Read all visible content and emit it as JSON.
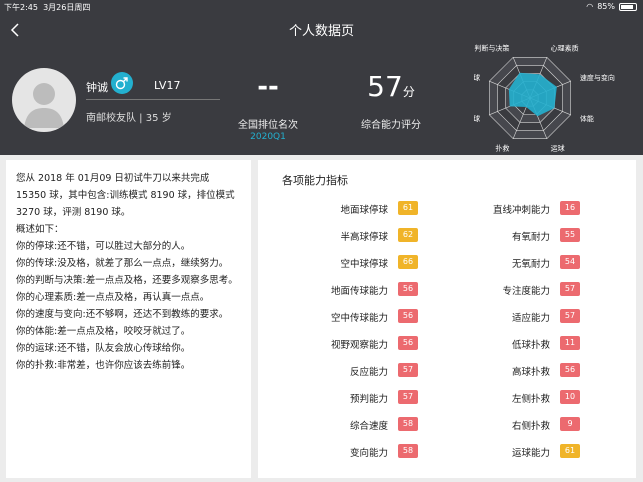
{
  "statusbar": {
    "time": "下午2:45",
    "date": "3月26日周四",
    "battery": "85%",
    "battery_level": 0.85
  },
  "header": {
    "title": "个人数据页"
  },
  "profile": {
    "name": "钟诚",
    "gender_icon": "male-icon",
    "level": "LV17",
    "team": "南邮校友队 | 35 岁"
  },
  "rank": {
    "value": "--",
    "label": "全国排位名次",
    "season": "2020Q1"
  },
  "score": {
    "value": "57",
    "unit": "分",
    "label": "综合能力评分"
  },
  "radar": {
    "labels": [
      "判断与决策",
      "心理素质",
      "速度与变向",
      "体能",
      "运球",
      "扑救",
      "停球",
      "传球"
    ],
    "values": [
      0.62,
      0.58,
      0.66,
      0.6,
      0.45,
      0.22,
      0.5,
      0.52
    ],
    "accent": "#23b0cf"
  },
  "summary": {
    "lines": [
      "您从 2018 年 01月09 日初试牛刀以来共完成 15350 球，其中包含:训练模式 8190 球，排位模式 3270 球，评测 8190 球。",
      "概述如下：",
      "你的停球:还不错，可以胜过大部分的人。",
      "你的传球:没及格，就差了那么一点点，继续努力。",
      "你的判断与决策:差一点点及格，还要多观察多思考。",
      "你的心理素质:差一点点及格，再认真一点点。",
      "你的速度与变向:还不够啊，还达不到教练的要求。",
      "你的体能:差一点点及格，咬咬牙就过了。",
      "你的运球:还不错，队友会放心传球给你。",
      "你的扑救:非常差，也许你应该去练前锋。"
    ]
  },
  "abilities": {
    "title": "各项能力指标",
    "colors": {
      "yellow": "#f0b429",
      "red": "#ec6a6f"
    },
    "left": [
      {
        "label": "地面球停球",
        "value": "61",
        "color": "yellow"
      },
      {
        "label": "半高球停球",
        "value": "62",
        "color": "yellow"
      },
      {
        "label": "空中球停球",
        "value": "66",
        "color": "yellow"
      },
      {
        "label": "地面传球能力",
        "value": "56",
        "color": "red"
      },
      {
        "label": "空中传球能力",
        "value": "56",
        "color": "red"
      },
      {
        "label": "视野观察能力",
        "value": "56",
        "color": "red"
      },
      {
        "label": "反应能力",
        "value": "57",
        "color": "red"
      },
      {
        "label": "预判能力",
        "value": "57",
        "color": "red"
      },
      {
        "label": "综合速度",
        "value": "58",
        "color": "red"
      },
      {
        "label": "变向能力",
        "value": "58",
        "color": "red"
      }
    ],
    "right": [
      {
        "label": "直线冲刺能力",
        "value": "16",
        "color": "red"
      },
      {
        "label": "有氧耐力",
        "value": "55",
        "color": "red"
      },
      {
        "label": "无氧耐力",
        "value": "54",
        "color": "red"
      },
      {
        "label": "专注度能力",
        "value": "57",
        "color": "red"
      },
      {
        "label": "适应能力",
        "value": "57",
        "color": "red"
      },
      {
        "label": "低球扑救",
        "value": "11",
        "color": "red"
      },
      {
        "label": "高球扑救",
        "value": "56",
        "color": "red"
      },
      {
        "label": "左侧扑救",
        "value": "10",
        "color": "red"
      },
      {
        "label": "右侧扑救",
        "value": "9",
        "color": "red"
      },
      {
        "label": "运球能力",
        "value": "61",
        "color": "yellow"
      }
    ]
  }
}
